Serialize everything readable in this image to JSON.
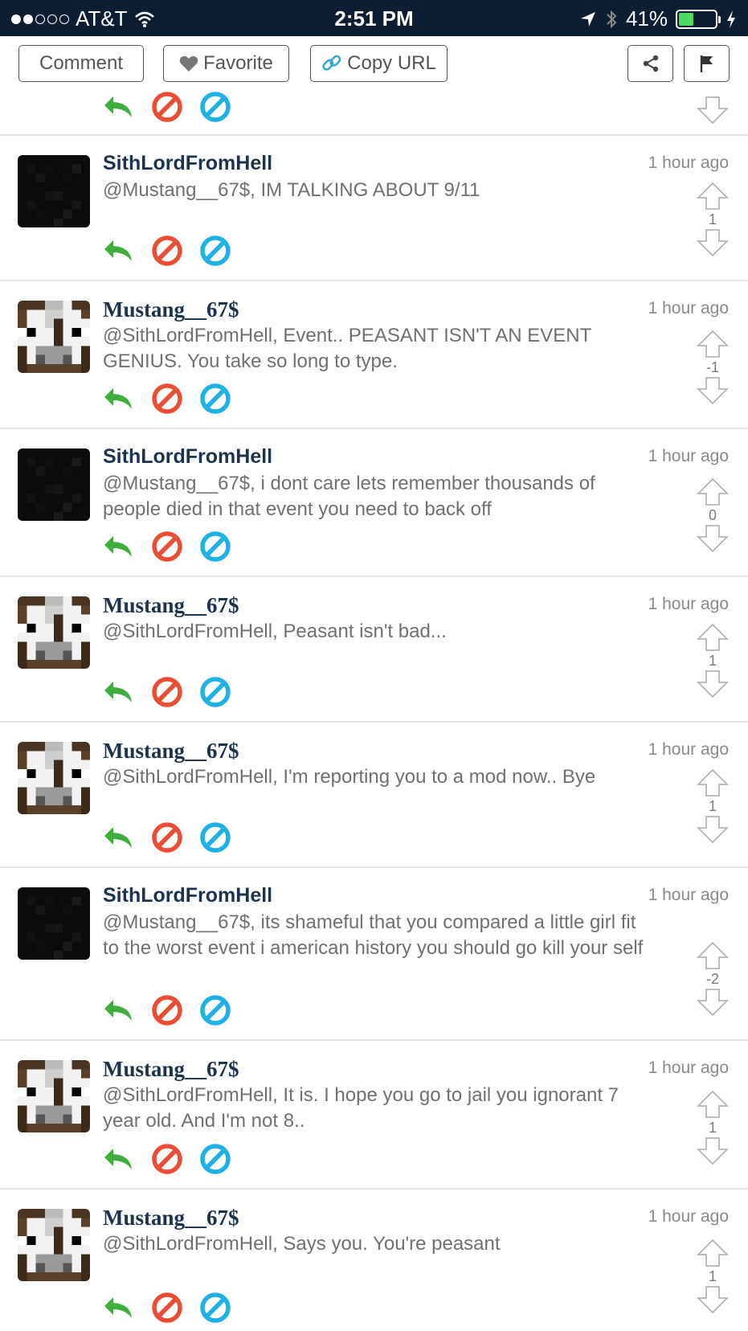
{
  "status_bar": {
    "carrier": "AT&T",
    "time": "2:51 PM",
    "battery": "41%"
  },
  "toolbar": {
    "comment_label": "Comment",
    "favorite_label": "Favorite",
    "copy_url_label": "Copy URL"
  },
  "comments": [
    {
      "author": "SithLordFromHell",
      "time": "1 hour ago",
      "text": "@Mustang__67$, IM TALKING ABOUT 9/11",
      "score": "1"
    },
    {
      "author": "Mustang__67$",
      "time": "1 hour ago",
      "text": "@SithLordFromHell, Event.. PEASANT ISN'T AN EVENT GENIUS. You take so long to type.",
      "score": "-1"
    },
    {
      "author": "SithLordFromHell",
      "time": "1 hour ago",
      "text": "@Mustang__67$, i dont care lets remember thousands of people died in that event you need to back off",
      "score": "0"
    },
    {
      "author": "Mustang__67$",
      "time": "1 hour ago",
      "text": "@SithLordFromHell, Peasant isn't bad...",
      "score": "1"
    },
    {
      "author": "Mustang__67$",
      "time": "1 hour ago",
      "text": "@SithLordFromHell, I'm reporting you to a mod now.. Bye",
      "score": "1"
    },
    {
      "author": "SithLordFromHell",
      "time": "1 hour ago",
      "text": "@Mustang__67$, its shameful that you compared a little girl fit to the worst event i american history you should go kill your self",
      "score": "-2"
    },
    {
      "author": "Mustang__67$",
      "time": "1 hour ago",
      "text": "@SithLordFromHell, It is. I hope you go to jail you ignorant 7 year old. And I'm not 8..",
      "score": "1"
    },
    {
      "author": "Mustang__67$",
      "time": "1 hour ago",
      "text": "@SithLordFromHell, Says you. You're peasant",
      "score": "1"
    }
  ]
}
